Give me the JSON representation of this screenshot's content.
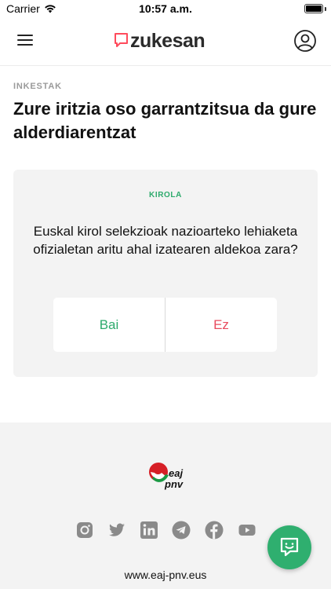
{
  "status_bar": {
    "carrier": "Carrier",
    "time": "10:57 a.m.",
    "wifi_icon": "wifi-icon",
    "battery_icon": "battery-icon"
  },
  "header": {
    "menu_icon": "hamburger-menu-icon",
    "logo_text": "zukesan",
    "profile_icon": "user-profile-icon",
    "brand_color": "#ff4b5c"
  },
  "main": {
    "section_label": "INKESTAK",
    "title": "Zure iritzia oso garrantzitsua da gure alderdiarentzat"
  },
  "poll": {
    "category": "KIROLA",
    "question": "Euskal kirol selekzioak nazioarteko lehiaketa ofizialetan aritu ahal izatearen aldekoa zara?",
    "options": [
      {
        "label": "Bai",
        "color": "#2daa6c"
      },
      {
        "label": "Ez",
        "color": "#e84b5e"
      }
    ]
  },
  "footer": {
    "party_logo_text_1": "eaj",
    "party_logo_text_2": "pnv",
    "social_icons": [
      "instagram-icon",
      "twitter-icon",
      "linkedin-icon",
      "telegram-icon",
      "facebook-icon",
      "youtube-icon"
    ],
    "url": "www.eaj-pnv.eus"
  },
  "chat_button": {
    "icon": "chat-smile-icon",
    "color": "#2faf6f"
  }
}
